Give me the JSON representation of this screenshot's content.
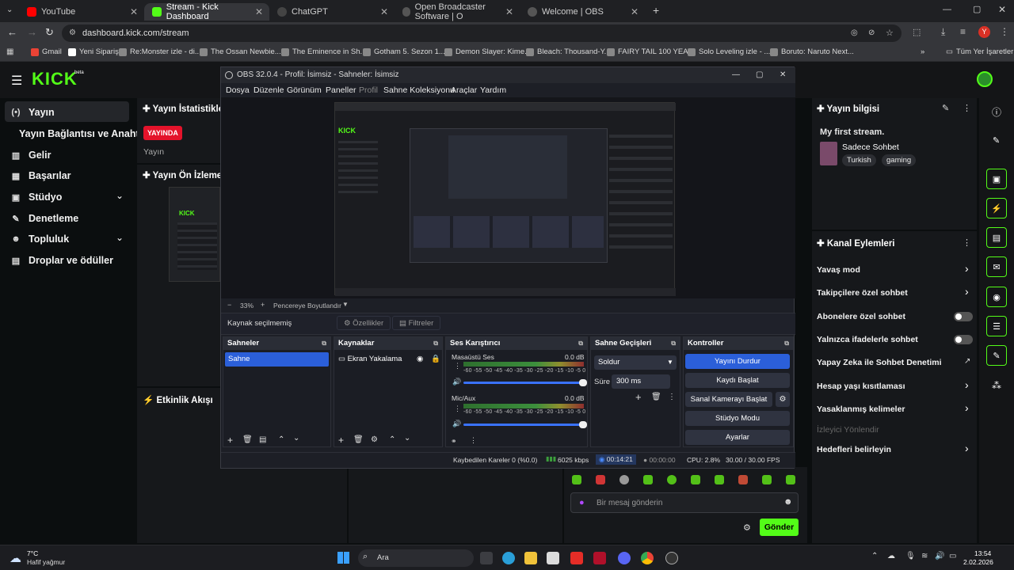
{
  "browser": {
    "tabs": [
      {
        "title": "YouTube",
        "color": "#ff0000"
      },
      {
        "title": "Stream - Kick Dashboard",
        "color": "#53fc18"
      },
      {
        "title": "ChatGPT",
        "color": "#cccccc"
      },
      {
        "title": "Open Broadcaster Software | O",
        "color": "#cccccc"
      },
      {
        "title": "Welcome | OBS",
        "color": "#cccccc"
      }
    ],
    "url": "dashboard.kick.com/stream",
    "bookmarks": [
      "Gmail",
      "Yeni Sipariş",
      "Re:Monster izle - di...",
      "The Ossan Newbie...",
      "The Eminence in Sh...",
      "Gotham 5. Sezon 1....",
      "Demon Slayer: Kime...",
      "Bleach: Thousand-Y...",
      "FAIRY TAIL 100 YEA...",
      "Solo Leveling izle - ...",
      "Boruto: Naruto Next..."
    ],
    "bookmarks_right": "Tüm Yer İşaretleri",
    "profile_letter": "Y"
  },
  "kick": {
    "logo": "KICK",
    "logo_badge": "beta",
    "sidebar": [
      {
        "label": "Yayın",
        "icon": "(•)"
      },
      {
        "label": "Yayın Bağlantısı ve Anahtarı",
        "icon": ""
      },
      {
        "label": "Gelir",
        "icon": "▥"
      },
      {
        "label": "Başarılar",
        "icon": "▦"
      },
      {
        "label": "Stüdyo",
        "icon": "▣"
      },
      {
        "label": "Denetleme",
        "icon": "✎"
      },
      {
        "label": "Topluluk",
        "icon": "☻"
      },
      {
        "label": "Droplar ve ödüller",
        "icon": "▤"
      }
    ],
    "stats_title": "Yayın İstatistikleri",
    "live_badge": "YAYINDA",
    "stats_sub": "Yayın",
    "preview_title": "Yayın Ön İzlemesi",
    "activity_title": "Etkinlik Akışı",
    "stream_info_title": "Yayın bilgisi",
    "stream_title": "My first stream.",
    "category": "Sadece Sohbet",
    "tags": [
      "Turkish",
      "gaming"
    ],
    "channel_actions_title": "Kanal Eylemleri",
    "actions": [
      {
        "label": "Yavaş mod",
        "kind": "chevron"
      },
      {
        "label": "Takipçilere özel sohbet",
        "kind": "chevron"
      },
      {
        "label": "Abonelere özel sohbet",
        "kind": "toggle"
      },
      {
        "label": "Yalnızca ifadelerle sohbet",
        "kind": "toggle"
      },
      {
        "label": "Yapay Zeka ile Sohbet Denetimi",
        "kind": "external"
      },
      {
        "label": "Hesap yaşı kısıtlaması",
        "kind": "chevron"
      },
      {
        "label": "Yasaklanmış kelimeler",
        "kind": "chevron"
      },
      {
        "label": "İzleyici Yönlendir",
        "kind": "disabled"
      },
      {
        "label": "Hedefleri belirleyin",
        "kind": "chevron"
      }
    ],
    "chat_placeholder": "Bir mesaj gönderin",
    "send_label": "Gönder"
  },
  "obs": {
    "title": "OBS 32.0.4 - Profil: İsimsiz - Sahneler: İsimsiz",
    "menu": [
      "Dosya",
      "Düzenle",
      "Görünüm",
      "Paneller",
      "Profil",
      "Sahne Koleksiyonu",
      "Araçlar",
      "Yardım"
    ],
    "zoom": "33%",
    "fit_label": "Pencereye Boyutlandır",
    "no_source": "Kaynak seçilmemiş",
    "properties": "Özellikler",
    "filters": "Filtreler",
    "scenes_title": "Sahneler",
    "scene_item": "Sahne",
    "sources_title": "Kaynaklar",
    "source_item": "Ekran Yakalama",
    "mixer_title": "Ses Karıştırıcı",
    "channels": [
      {
        "name": "Masaüstü Ses",
        "db": "0.0 dB"
      },
      {
        "name": "Mic/Aux",
        "db": "0.0 dB"
      }
    ],
    "meter_ticks": "-60 -55 -50 -45 -40 -35 -30 -25 -20 -15 -10 -5 0",
    "transitions_title": "Sahne Geçişleri",
    "transition": "Soldur",
    "duration_label": "Süre",
    "duration_value": "300 ms",
    "controls_title": "Kontroller",
    "controls": [
      "Yayını Durdur",
      "Kaydı Başlat",
      "Sanal Kamerayı Başlat",
      "Stüdyo Modu",
      "Ayarlar"
    ],
    "status": {
      "dropped": "Kaybedilen Kareler 0 (%0.0)",
      "bitrate": "6025 kbps",
      "live_time": "00:14:21",
      "rec_time": "00:00:00",
      "cpu": "CPU: 2.8%",
      "fps": "30.00 / 30.00 FPS"
    }
  },
  "taskbar": {
    "weather_temp": "7°C",
    "weather_desc": "Hafif yağmur",
    "search": "Ara",
    "time": "13:54",
    "date": "2.02.2026"
  },
  "colors": {
    "kick_green": "#53fc18",
    "live_red": "#e4132b",
    "obs_blue": "#2b5fd9"
  }
}
